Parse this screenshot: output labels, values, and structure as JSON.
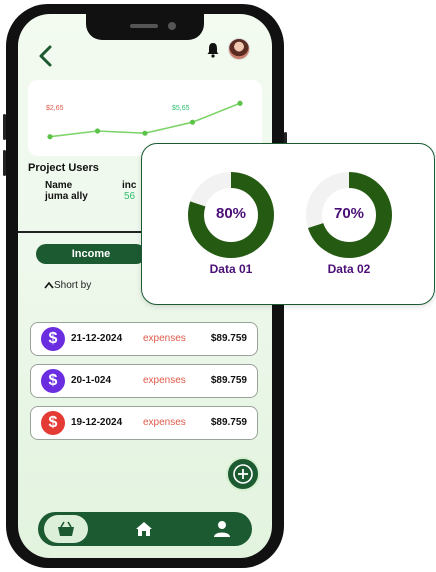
{
  "chart": {
    "labels": [
      "$2,65",
      "$5,65"
    ],
    "label_colors": [
      "#e05a4a",
      "#2fbf71"
    ],
    "points": [
      0.12,
      0.25,
      0.2,
      0.45,
      0.88
    ],
    "line_color": "#7fd36b"
  },
  "users": {
    "title": "Project Users",
    "col_name": "Name",
    "col_income": "inc",
    "rows": [
      {
        "name": "juma ally",
        "income": "56"
      }
    ]
  },
  "filter": {
    "income_label": "Income",
    "sort_label": "Short by"
  },
  "transactions": [
    {
      "date": "21-12-2024",
      "type": "expenses",
      "amount": "$89.759",
      "icon_color": "#6b2de0"
    },
    {
      "date": "20-1-024",
      "type": "expenses",
      "amount": "$89.759",
      "icon_color": "#6b2de0"
    },
    {
      "date": "19-12-2024",
      "type": "expenses",
      "amount": "$89.759",
      "icon_color": "#e53b35"
    }
  ],
  "icons": {
    "back": "back-arrow-icon",
    "notification": "bell-icon",
    "add": "plus-circle-icon",
    "nav": [
      "basket-icon",
      "home-icon",
      "user-icon"
    ],
    "currency": "dollar-icon"
  },
  "stats": [
    {
      "label": "Data 01",
      "percent_text": "80%",
      "value": 0.8
    },
    {
      "label": "Data 02",
      "percent_text": "70%",
      "value": 0.7
    }
  ],
  "colors": {
    "primary": "#1c5a32",
    "donut_track": "#f2f2f2",
    "donut_fill": "#255a12",
    "accent_text": "#4b1077"
  }
}
